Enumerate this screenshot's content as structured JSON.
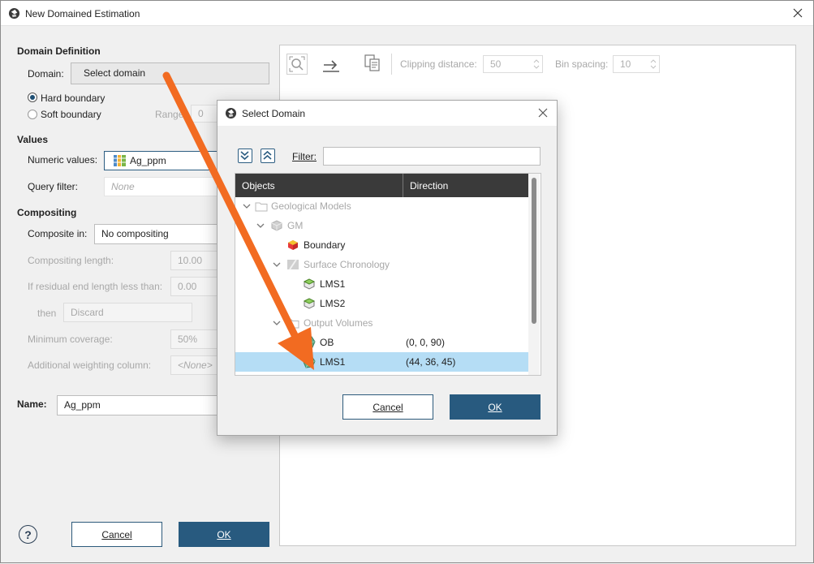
{
  "window": {
    "title": "New Domained Estimation"
  },
  "domain_definition": {
    "heading": "Domain Definition",
    "domain_label": "Domain:",
    "domain_button": "Select domain",
    "hard_boundary": "Hard boundary",
    "soft_boundary": "Soft boundary",
    "range_label": "Range:",
    "range_value": "0"
  },
  "values": {
    "heading": "Values",
    "numeric_label": "Numeric values:",
    "numeric_value": "Ag_ppm",
    "query_label": "Query filter:",
    "query_value": "None"
  },
  "compositing": {
    "heading": "Compositing",
    "composite_label": "Composite in:",
    "composite_value": "No compositing",
    "length_label": "Compositing length:",
    "length_value": "10.00",
    "residual_label": "If residual end length less than:",
    "residual_value": "0.00",
    "then_label": "then",
    "then_value": "Discard",
    "coverage_label": "Minimum coverage:",
    "coverage_value": "50%",
    "weighting_label": "Additional weighting column:",
    "weighting_value": "<None>"
  },
  "name": {
    "label": "Name:",
    "value": "Ag_ppm"
  },
  "main_buttons": {
    "cancel": "Cancel",
    "ok": "OK",
    "help": "?"
  },
  "toolbar": {
    "clipping_label": "Clipping distance:",
    "clipping_value": "50",
    "bin_label": "Bin spacing:",
    "bin_value": "10"
  },
  "dialog": {
    "title": "Select Domain",
    "filter_label": "Filter:",
    "filter_value": "",
    "col_objects": "Objects",
    "col_direction": "Direction",
    "rows": [
      {
        "label": "Geological Models",
        "direction": ""
      },
      {
        "label": "GM",
        "direction": ""
      },
      {
        "label": "Boundary",
        "direction": ""
      },
      {
        "label": "Surface Chronology",
        "direction": ""
      },
      {
        "label": "LMS1",
        "direction": ""
      },
      {
        "label": "LMS2",
        "direction": ""
      },
      {
        "label": "Output Volumes",
        "direction": ""
      },
      {
        "label": "OB",
        "direction": "(0, 0, 90)"
      },
      {
        "label": "LMS1",
        "direction": "(44, 36, 45)"
      }
    ],
    "cancel": "Cancel",
    "ok": "OK"
  },
  "colors": {
    "accent": "#285a7f",
    "selection": "#b5ddf5",
    "header": "#3a3a3a",
    "annotation_arrow": "#f26b21"
  }
}
